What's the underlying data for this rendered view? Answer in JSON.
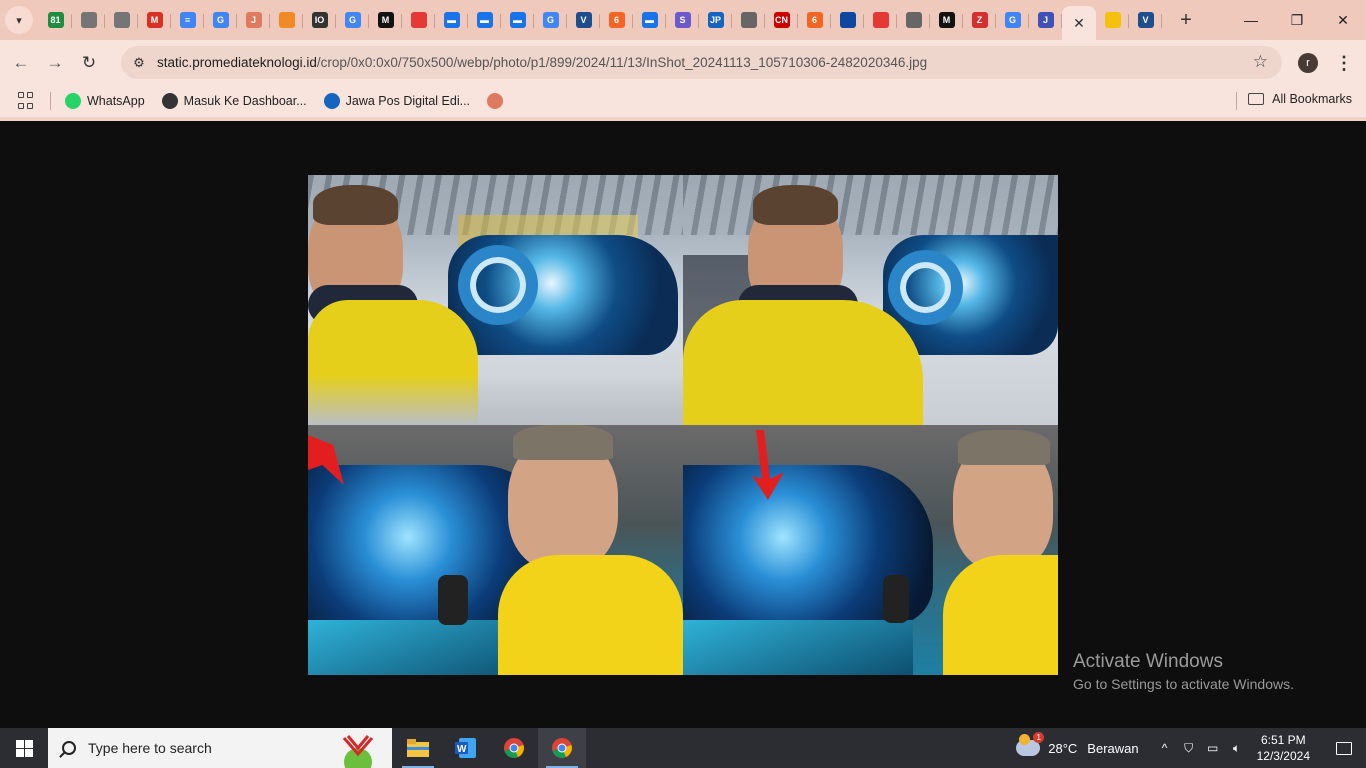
{
  "tabs": [
    {
      "name": "tab-sheets",
      "icon": "sheets-icon",
      "color": "#1e8e3e",
      "glyph": "81"
    },
    {
      "name": "tab-globe-1",
      "icon": "globe-icon",
      "color": "#757575",
      "glyph": ""
    },
    {
      "name": "tab-globe-2",
      "icon": "globe-icon",
      "color": "#757575",
      "glyph": ""
    },
    {
      "name": "tab-gmail",
      "icon": "gmail-icon",
      "color": "#d93025",
      "glyph": "M"
    },
    {
      "name": "tab-docs",
      "icon": "docs-icon",
      "color": "#4285f4",
      "glyph": "≡"
    },
    {
      "name": "tab-google-1",
      "icon": "google-icon",
      "color": "#4285f4",
      "glyph": "G"
    },
    {
      "name": "tab-jdn",
      "icon": "jdn-icon",
      "color": "#e07a5f",
      "glyph": "J"
    },
    {
      "name": "tab-orange",
      "icon": "orange-site-icon",
      "color": "#f08a24",
      "glyph": ""
    },
    {
      "name": "tab-io",
      "icon": "io-icon",
      "color": "#333333",
      "glyph": "IO"
    },
    {
      "name": "tab-google-2",
      "icon": "google-icon",
      "color": "#4285f4",
      "glyph": "G"
    },
    {
      "name": "tab-m-1",
      "icon": "m-logo-icon",
      "color": "#111111",
      "glyph": "M"
    },
    {
      "name": "tab-red-ball-1",
      "icon": "red-ball-icon",
      "color": "#e53935",
      "glyph": ""
    },
    {
      "name": "tab-news-1",
      "icon": "news-icon",
      "color": "#1a73e8",
      "glyph": "▬"
    },
    {
      "name": "tab-news-2",
      "icon": "news-icon",
      "color": "#1a73e8",
      "glyph": "▬"
    },
    {
      "name": "tab-news-3",
      "icon": "news-icon",
      "color": "#1a73e8",
      "glyph": "▬"
    },
    {
      "name": "tab-google-3",
      "icon": "google-icon",
      "color": "#4285f4",
      "glyph": "G"
    },
    {
      "name": "tab-v",
      "icon": "v-logo-icon",
      "color": "#1f4e8c",
      "glyph": "V"
    },
    {
      "name": "tab-six-1",
      "icon": "six-icon",
      "color": "#f26522",
      "glyph": "6"
    },
    {
      "name": "tab-news-4",
      "icon": "news-icon",
      "color": "#1a73e8",
      "glyph": "▬"
    },
    {
      "name": "tab-bird",
      "icon": "bird-icon",
      "color": "#6a5acd",
      "glyph": "S"
    },
    {
      "name": "tab-jp",
      "icon": "jp-icon",
      "color": "#1565c0",
      "glyph": "JP"
    },
    {
      "name": "tab-shield-1",
      "icon": "shield-icon",
      "color": "#666666",
      "glyph": ""
    },
    {
      "name": "tab-cnn",
      "icon": "cnn-icon",
      "color": "#cc0000",
      "glyph": "CN"
    },
    {
      "name": "tab-six-2",
      "icon": "six-icon",
      "color": "#f26522",
      "glyph": "6"
    },
    {
      "name": "tab-circle",
      "icon": "circle-logo-icon",
      "color": "#0d47a1",
      "glyph": ""
    },
    {
      "name": "tab-red-ball-2",
      "icon": "red-ball-icon",
      "color": "#e53935",
      "glyph": ""
    },
    {
      "name": "tab-shield-2",
      "icon": "shield-icon",
      "color": "#666666",
      "glyph": ""
    },
    {
      "name": "tab-m-2",
      "icon": "m-logo-icon",
      "color": "#111111",
      "glyph": "M"
    },
    {
      "name": "tab-z",
      "icon": "z-logo-icon",
      "color": "#d32f2f",
      "glyph": "Z"
    },
    {
      "name": "tab-google-4",
      "icon": "google-icon",
      "color": "#4285f4",
      "glyph": "G"
    },
    {
      "name": "tab-jm",
      "icon": "jm-icon",
      "color": "#3f51b5",
      "glyph": "J"
    }
  ],
  "tabs_after_active": [
    {
      "name": "tab-yellow",
      "icon": "yellow-square-icon",
      "color": "#f4c20d",
      "glyph": ""
    },
    {
      "name": "tab-v-2",
      "icon": "v-logo-icon",
      "color": "#1f4e8c",
      "glyph": "V"
    }
  ],
  "active_tab": {
    "close_label": "✕"
  },
  "window": {
    "minimize": "—",
    "restore": "❐",
    "close": "✕"
  },
  "toolbar": {
    "url_host": "static.promediateknologi.id",
    "url_path": "/crop/0x0:0x0/750x500/webp/photo/p1/899/2024/11/13/InShot_20241113_105710306-2482020346.jpg",
    "profile_initial": "r",
    "back": "←",
    "forward": "→",
    "reload": "↻",
    "star": "☆",
    "menu": "⋮",
    "tune": "⚙"
  },
  "bookmarks": [
    {
      "name": "bookmark-whatsapp",
      "label": "WhatsApp",
      "icon": "whatsapp-icon",
      "color": "#25d366"
    },
    {
      "name": "bookmark-dashboard",
      "label": "Masuk Ke Dashboar...",
      "icon": "globe-icon",
      "color": "#333333"
    },
    {
      "name": "bookmark-jawapos",
      "label": "Jawa Pos Digital Edi...",
      "icon": "jp-icon",
      "color": "#1565c0"
    },
    {
      "name": "bookmark-jdn",
      "label": "",
      "icon": "jdn-icon",
      "color": "#e07a5f"
    }
  ],
  "all_bookmarks": "All Bookmarks",
  "activate_windows": {
    "title": "Activate Windows",
    "subtitle": "Go to Settings to activate Windows."
  },
  "taskbar": {
    "search_placeholder": "Type here to search",
    "weather_temp": "28°C",
    "weather_desc": "Berawan",
    "weather_badge": "1",
    "time": "6:51 PM",
    "date": "12/3/2024",
    "tray_chevron": "^"
  }
}
